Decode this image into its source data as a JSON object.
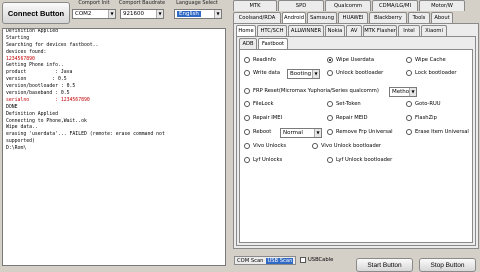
{
  "top": {
    "connect_label": "Connect Button",
    "comport_label": "Comport Init",
    "comport_value": "COM2",
    "baud_label": "Comport Baudrate",
    "baud_value": "921600",
    "lang_label": "Language Select",
    "lang_value": "English"
  },
  "console_lines": [
    "Definition Applied",
    "Starting",
    "Searching for devices fastboot..",
    "devices found:",
    "1234567890",
    "Getting Phone info..",
    "product          : Java",
    "version         : 0.5",
    "version/bootloader : 0.5",
    "version/baseband : 0.5",
    "serialno         : 1234567890",
    "DONE",
    "Definition Applied",
    "Connecting to Phone,Wait..ok",
    "Wipe data..",
    "erasing 'userdata'... FAILED (remote: erase command not",
    "supported)",
    "D:\\Rom\\"
  ],
  "tabs_row1": [
    "MTK",
    "SPD",
    "Qualcomm",
    "CDMA/LG/MI",
    "Motor/W"
  ],
  "tabs_row2": [
    "Coolsand/RDA",
    "Android",
    "Samsung",
    "HUAWEI",
    "Blackberry",
    "Tools",
    "About"
  ],
  "tabs_row3": [
    "Home",
    "HTC/SCH",
    "ALLWINNER",
    "Nokia",
    "AV",
    "MTK Flasher",
    "Intel",
    "Xiaomi"
  ],
  "tabs_row4": [
    "ADB",
    "Fastboot"
  ],
  "options": {
    "readinfo": "Readinfo",
    "wipe_userdata": "Wipe Userdata",
    "wipe_cache": "Wipe Cache",
    "write_data": "Write data",
    "write_data_value": "Booting",
    "unlock_bootloader": "Unlock bootloader",
    "lock_bootloader": "Lock bootloader",
    "frp_reset": "FRP Reset(Micromax Yuphoria/Series qualcomm)",
    "frp_value": "Method1",
    "file_lock": "FileLock",
    "set_token": "Set-Token",
    "goto_ruu": "Goto-RUU",
    "repair_imei": "Repair IMEI",
    "repair_meid": "Repair MEID",
    "flash_zip": "FlashZip",
    "reboot": "Reboot",
    "reboot_value": "Normal",
    "remove_frp": "Remove Frp Universal",
    "erase_item": "Erase Item Universal",
    "vivo_unlocks": "Vivo Unlocks",
    "vivo_unlock_bl": "Vivo Unlock bootloader",
    "lyf_unlocks": "Lyf Unlocks",
    "lyf_unlock_bl": "Lyf Unlock bootloader"
  },
  "bottom": {
    "com_scan": "COM Scan",
    "usb_scan": "USB Scan",
    "usb_cable": "USBCable",
    "start": "Start Button",
    "stop": "Stop Button"
  },
  "colors": {
    "bg": "#d4d0c8",
    "console_bg": "#ffffff",
    "panel_bg": "#ffffff"
  }
}
